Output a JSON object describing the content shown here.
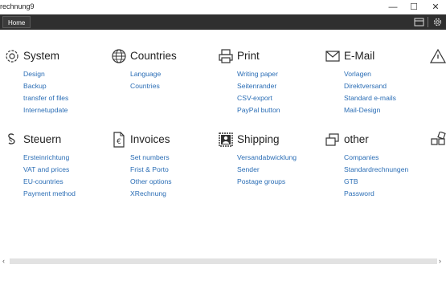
{
  "window": {
    "title": "rechnung9",
    "minimize_glyph": "—",
    "maximize_glyph": "☐",
    "close_glyph": "✕"
  },
  "toolbar": {
    "home_tab": "Home",
    "icons": [
      "card-icon",
      "settings-icon"
    ]
  },
  "groups": [
    {
      "title": "System",
      "icon": "gear-icon",
      "items": [
        "Design",
        "Backup",
        "transfer of files",
        "Internetupdate"
      ]
    },
    {
      "title": "Countries",
      "icon": "globe-icon",
      "items": [
        "Language",
        "Countries"
      ]
    },
    {
      "title": "Print",
      "icon": "printer-icon",
      "items": [
        "Writing paper",
        "Seitenrander",
        "CSV-export",
        "PayPal button"
      ]
    },
    {
      "title": "E-Mail",
      "icon": "envelope-icon",
      "items": [
        "Vorlagen",
        "Direktversand",
        "Standard e-mails",
        "Mail-Design"
      ]
    },
    {
      "title": "",
      "icon": "warning-icon",
      "items": []
    },
    {
      "title": "Steuern",
      "icon": "paragraph-icon",
      "items": [
        "Ersteinrichtung",
        "VAT and prices",
        "EU-countries",
        "Payment method"
      ]
    },
    {
      "title": "Invoices",
      "icon": "euro-document-icon",
      "items": [
        "Set numbers",
        "Frist & Porto",
        "Other options",
        "XRechnung"
      ]
    },
    {
      "title": "Shipping",
      "icon": "stamp-icon",
      "items": [
        "Versandabwicklung",
        "Sender",
        "Postage groups"
      ]
    },
    {
      "title": "other",
      "icon": "windows-icon",
      "items": [
        "Companies",
        "Standardrechnungen",
        "GTB",
        "Password"
      ]
    },
    {
      "title": "",
      "icon": "blocks-icon",
      "items": []
    }
  ],
  "scrollbar": {
    "left_arrow": "‹",
    "right_arrow": "›"
  }
}
